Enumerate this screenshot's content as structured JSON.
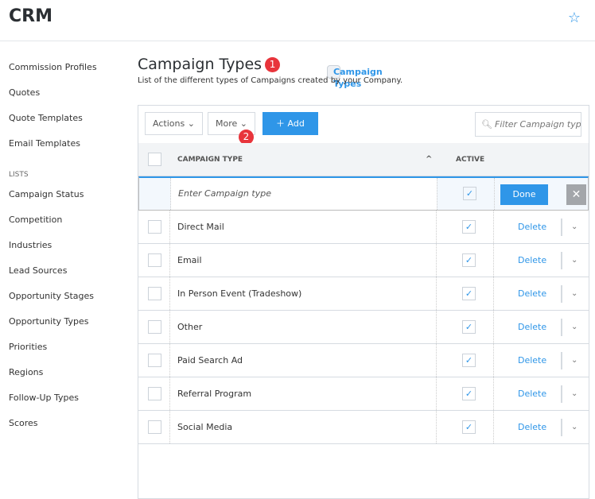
{
  "app": {
    "title": "CRM"
  },
  "sidebar": {
    "items_top": [
      "Commission Profiles",
      "Quotes",
      "Quote Templates",
      "Email Templates"
    ],
    "section": "LISTS",
    "items": [
      "Campaign Status",
      "Campaign Types",
      "Competition",
      "Industries",
      "Lead Sources",
      "Opportunity Stages",
      "Opportunity Types",
      "Priorities",
      "Regions",
      "Follow-Up Types",
      "Scores"
    ],
    "active": "Campaign Types"
  },
  "page": {
    "title": "Campaign Types",
    "badge1": "1",
    "badge2": "2",
    "subtitle": "List of the different types of Campaigns created by your Company."
  },
  "toolbar": {
    "actions": "Actions",
    "more": "More",
    "add": "Add",
    "filter_placeholder": "Filter Campaign type"
  },
  "table": {
    "col_type": "CAMPAIGN TYPE",
    "col_active": "ACTIVE",
    "new_placeholder": "Enter Campaign type",
    "done": "Done",
    "delete": "Delete",
    "rows": [
      {
        "name": "Direct Mail",
        "active": true
      },
      {
        "name": "Email",
        "active": true
      },
      {
        "name": "In Person Event (Tradeshow)",
        "active": true
      },
      {
        "name": "Other",
        "active": true
      },
      {
        "name": "Paid Search Ad",
        "active": true
      },
      {
        "name": "Referral Program",
        "active": true
      },
      {
        "name": "Social Media",
        "active": true
      }
    ]
  },
  "colors": {
    "accent": "#2f96e8",
    "badge": "#e8343b"
  }
}
